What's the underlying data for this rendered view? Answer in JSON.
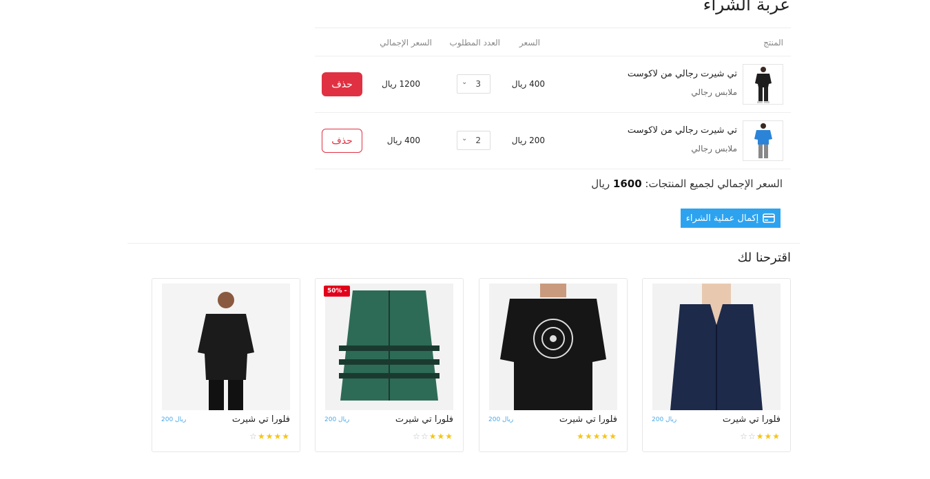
{
  "page_title": "عربة الشراء",
  "cart": {
    "headers": {
      "product": "المنتج",
      "price": "السعر",
      "quantity": "العدد المطلوب",
      "total": "السعر الإجمالي"
    },
    "rows": [
      {
        "name": "تي شيرت رجالي من لاكوست",
        "category": "ملابس رجالي",
        "price": "400 ريال",
        "quantity": "3",
        "total": "1200 ريال",
        "delete_label": "حذف",
        "shirt_color": "#1e1e1e"
      },
      {
        "name": "تي شيرت رجالي من لاكوست",
        "category": "ملابس رجالي",
        "price": "200 ريال",
        "quantity": "2",
        "total": "400 ريال",
        "delete_label": "حذف",
        "shirt_color": "#2b84d8"
      }
    ],
    "grand_total_label": "السعر الإجمالي لجميع المنتجات:",
    "grand_total_value": "1600",
    "grand_total_currency": "ريال",
    "checkout_label": "إكمال عملية الشراء"
  },
  "suggestions": {
    "title": "اقترحنا لك",
    "items": [
      {
        "name": "فلورا تي شيرت",
        "price": "200 ريال",
        "rating": 3,
        "image": "blouse"
      },
      {
        "name": "فلورا تي شيرت",
        "price": "200 ريال",
        "rating": 5,
        "image": "printed-tee"
      },
      {
        "name": "فلورا تي شيرت",
        "price": "200 ريال",
        "rating": 3,
        "image": "green-jacket",
        "badge": "50% -"
      },
      {
        "name": "فلورا تي شيرت",
        "price": "200 ريال",
        "rating": 4,
        "image": "man-black-tee"
      }
    ]
  },
  "colors": {
    "accent": "#2da3f0",
    "danger": "#e03142",
    "star": "#f5c518",
    "price": "#4aa8e8",
    "badge": "#e2001a"
  }
}
